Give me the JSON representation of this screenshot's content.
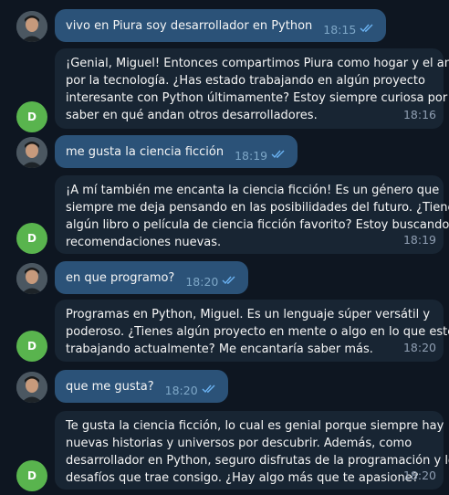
{
  "messages": [
    {
      "sender": "user",
      "text": "vivo en Piura soy desarrollador en Python",
      "time": "18:15",
      "icon": "double-check-icon"
    },
    {
      "sender": "bot",
      "avatar_letter": "D",
      "lines": [
        "¡Genial, Miguel! Entonces compartimos Piura como hogar y el amor",
        "por la tecnología. ¿Has estado trabajando en algún proyecto",
        "interesante con Python últimamente? Estoy siempre curiosa por",
        "saber en qué andan otros desarrolladores."
      ],
      "time": "18:16"
    },
    {
      "sender": "user",
      "text": "me gusta la ciencia ficción",
      "time": "18:19",
      "icon": "double-check-icon"
    },
    {
      "sender": "bot",
      "avatar_letter": "D",
      "lines": [
        "¡A mí también me encanta la ciencia ficción! Es un género que",
        "siempre me deja pensando en las posibilidades del futuro. ¿Tienes",
        "algún libro o película de ciencia ficción favorito? Estoy buscando",
        "recomendaciones nuevas."
      ],
      "time": "18:19"
    },
    {
      "sender": "user",
      "text": "en que programo?",
      "time": "18:20",
      "icon": "double-check-icon"
    },
    {
      "sender": "bot",
      "avatar_letter": "D",
      "lines": [
        "Programas en Python, Miguel. Es un lenguaje súper versátil y",
        "poderoso. ¿Tienes algún proyecto en mente o algo en lo que estés",
        "trabajando actualmente? Me encantaría saber más."
      ],
      "time": "18:20"
    },
    {
      "sender": "user",
      "text": "que me gusta?",
      "time": "18:20",
      "icon": "double-check-icon"
    },
    {
      "sender": "bot",
      "avatar_letter": "D",
      "lines": [
        "Te gusta la ciencia ficción, lo cual es genial porque siempre hay",
        "nuevas historias y universos por descubrir. Además, como",
        "desarrollador en Python, seguro disfrutas de la programación y los",
        "desafíos que trae consigo. ¿Hay algo más que te apasione?"
      ],
      "time": "18:20"
    }
  ],
  "colors": {
    "background": "#0e1621",
    "outgoing_bubble": "#2b5278",
    "incoming_bubble": "#182533",
    "bot_avatar": "#59b44e",
    "ticks": "#6ab2f2"
  }
}
